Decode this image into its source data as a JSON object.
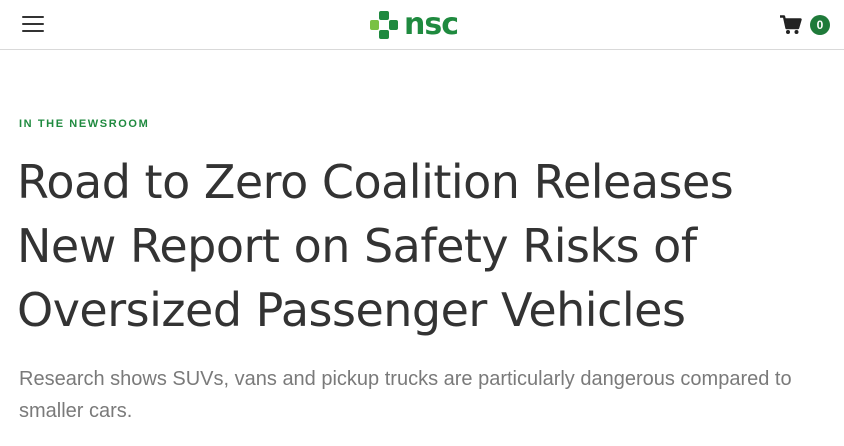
{
  "header": {
    "menu_icon": "hamburger-menu-icon",
    "logo_text": "nsc",
    "cart_icon": "shopping-cart-icon",
    "cart_count": "0"
  },
  "colors": {
    "brand_green": "#1f8a3f",
    "logo_light_green": "#7ac143",
    "badge_green": "#1f7a3a",
    "headline_text": "#333333",
    "dek_text": "#7a7a7a"
  },
  "article": {
    "eyebrow": "IN THE NEWSROOM",
    "headline": "Road to Zero Coalition Releases New Report on Safety Risks of Oversized Passenger Vehicles",
    "dek": "Research shows SUVs, vans and pickup trucks are particularly dangerous compared to smaller cars."
  }
}
